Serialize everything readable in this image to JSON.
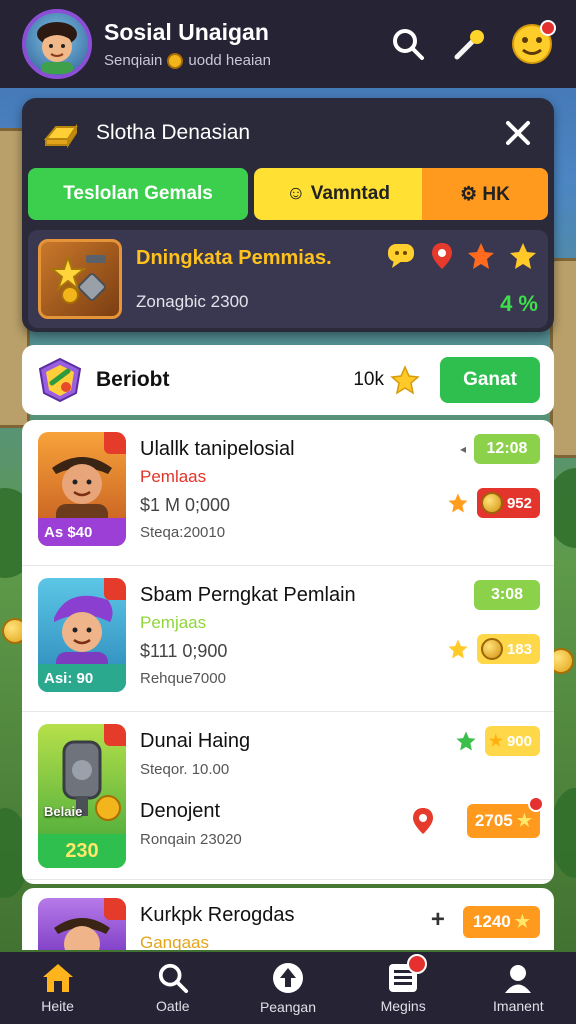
{
  "header": {
    "title": "Sosial Unaigan",
    "subtitle_left": "Senqiain",
    "subtitle_right": "uodd heaian"
  },
  "panel": {
    "title": "Slotha Denasian",
    "tabs": [
      {
        "label": "Teslolan Gemals"
      },
      {
        "label": "☺ Vamntad"
      },
      {
        "label": "⚙ HK"
      }
    ],
    "reward": {
      "title": "Dningkata Pemmias.",
      "subtitle": "Zonagbic 2300",
      "score": "4 %"
    }
  },
  "section": {
    "title": "Beriobt",
    "count": "10k",
    "button": "Ganat"
  },
  "items": [
    {
      "title": "Ulallk tanipelosial",
      "sub": "Pemlaas",
      "sub_color": "#e0342a",
      "price": "$1 M 0;000",
      "meta": "Steqa:20010",
      "tag": "As $40",
      "time": "12:08",
      "value": "952",
      "value_color": "#e4352c"
    },
    {
      "title": "Sbam Perngkat Pemlain",
      "sub": "Pemjaas",
      "sub_color": "#8fd63a",
      "price": "$111 0;900",
      "meta": "Rehque7000",
      "tag": "Asi: 90",
      "time": "3:08",
      "value": "183",
      "value_color": "#ffd84a"
    },
    {
      "title": "Dunai Haing",
      "meta": "Steqor. 10.00",
      "title2": "Denojent",
      "meta2": "Ronqain 23020",
      "tag_top": "Belaie",
      "tag": "230",
      "value": "900",
      "value2": "2705"
    }
  ],
  "partial": {
    "title": "Kurkpk Rerogdas",
    "sub": "Ganqaas",
    "value": "1240"
  },
  "nav": [
    {
      "label": "Heite"
    },
    {
      "label": "Oatle"
    },
    {
      "label": "Peangan"
    },
    {
      "label": "Megins"
    },
    {
      "label": "Imanent"
    }
  ]
}
